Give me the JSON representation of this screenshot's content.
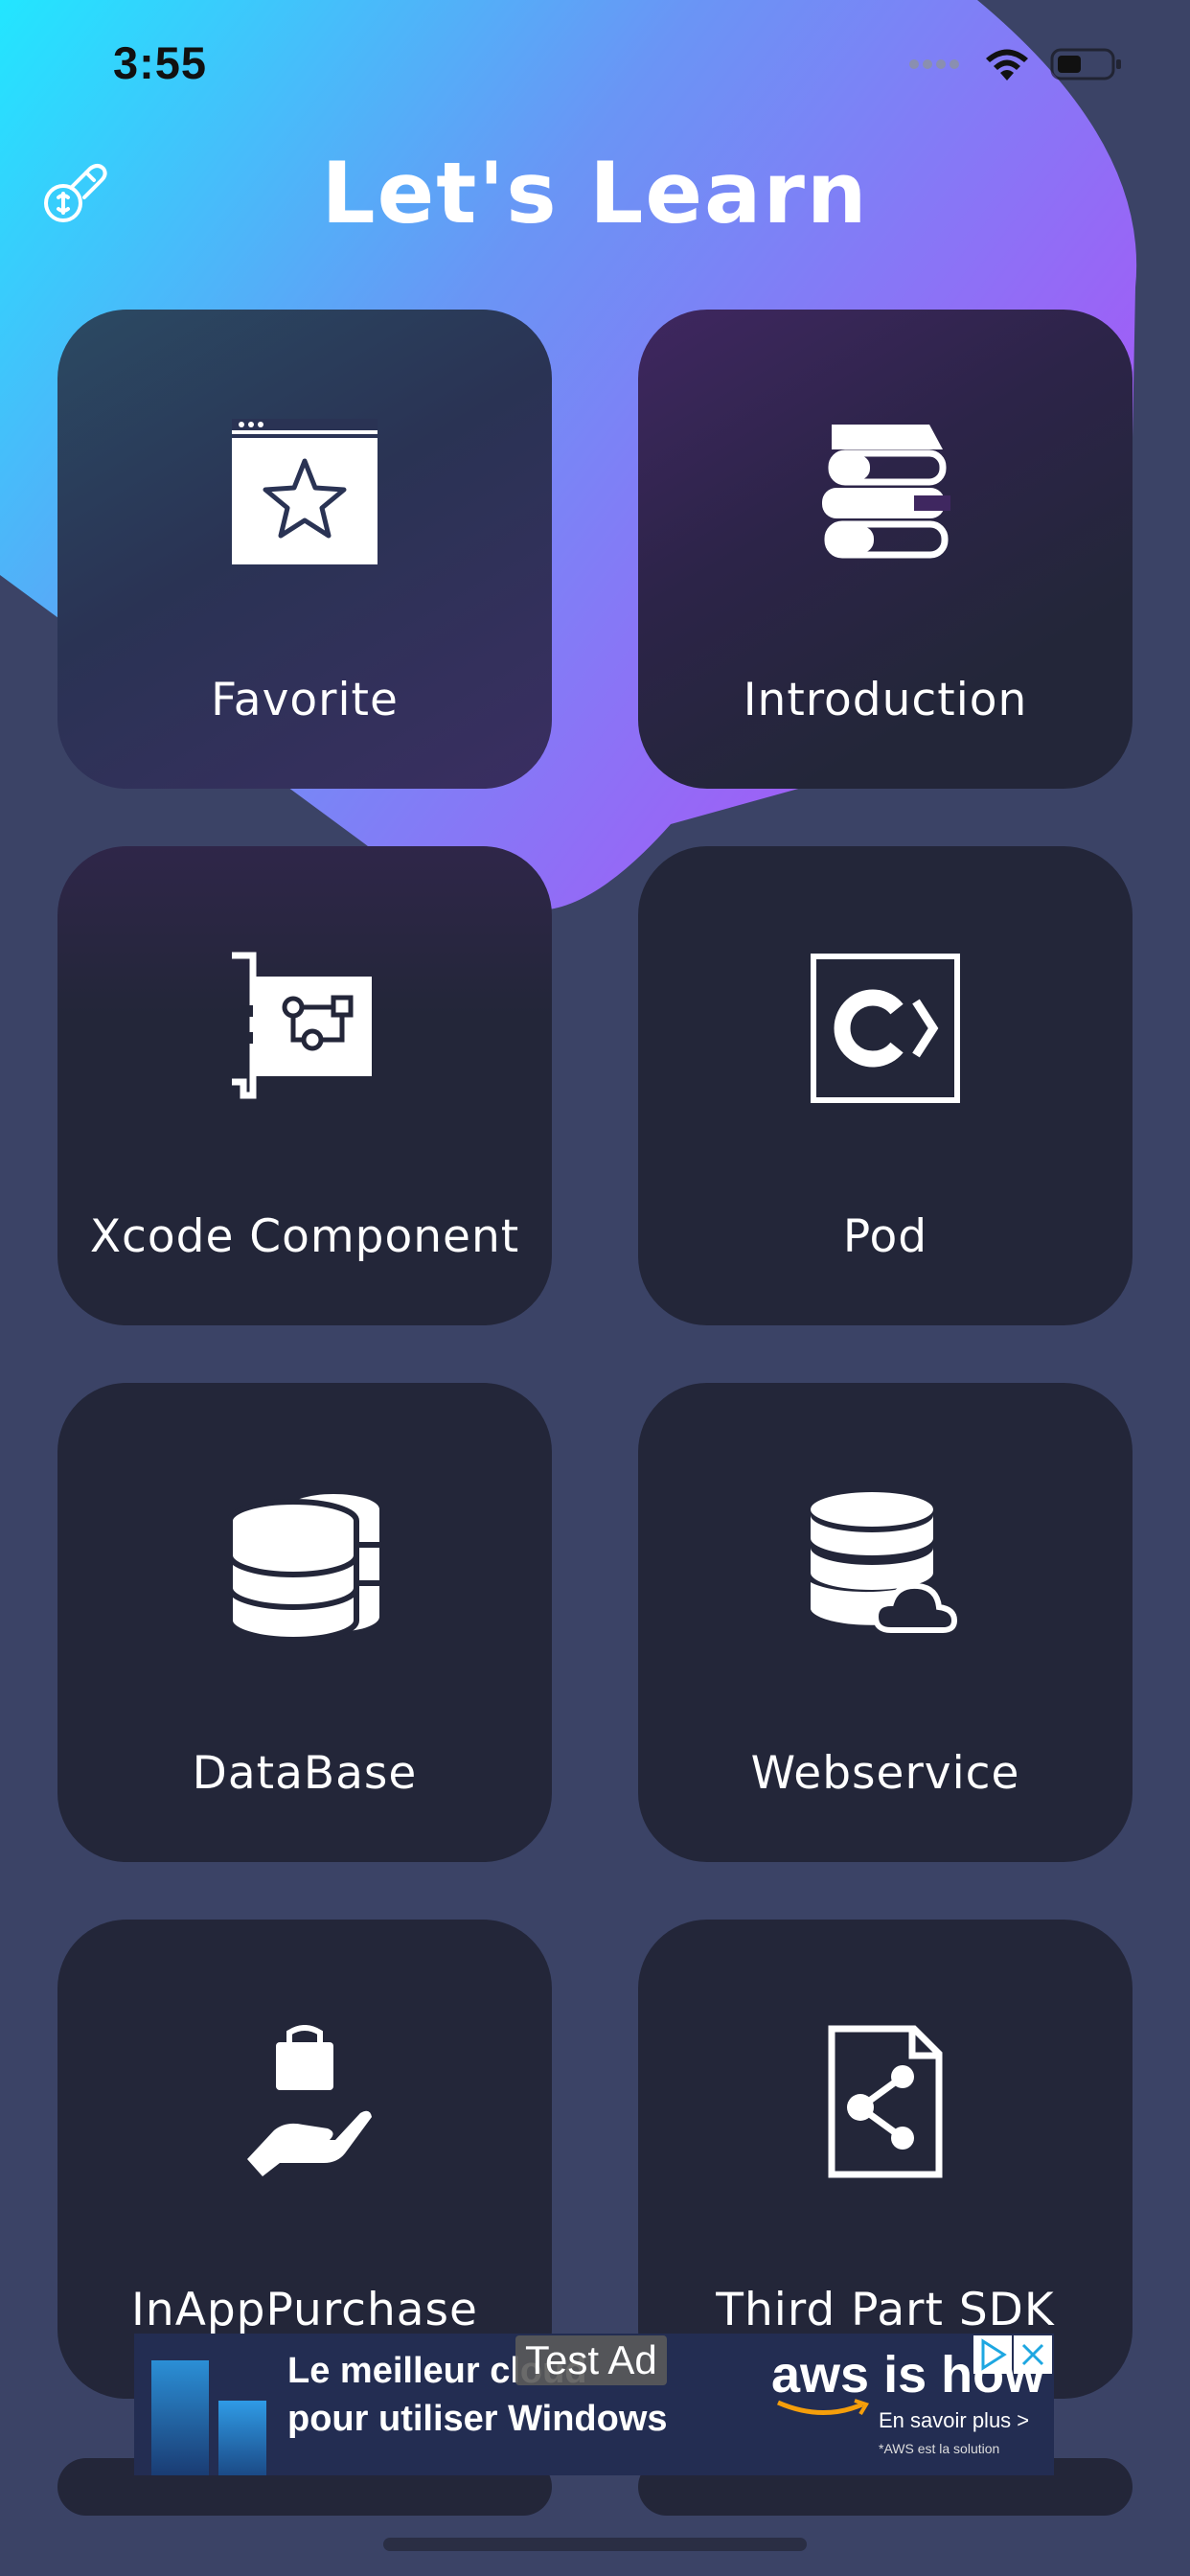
{
  "status_bar": {
    "time": "3:55"
  },
  "header": {
    "title": "Let's Learn",
    "icon": "hand-coin-icon"
  },
  "cards": [
    {
      "label": "Favorite",
      "icon": "browser-star-icon"
    },
    {
      "label": "Introduction",
      "icon": "books-icon"
    },
    {
      "label": "Xcode Component",
      "icon": "circuit-card-icon"
    },
    {
      "label": "Pod",
      "icon": "code-box-icon"
    },
    {
      "label": "DataBase",
      "icon": "database-icon"
    },
    {
      "label": "Webservice",
      "icon": "cloud-database-icon"
    },
    {
      "label": "InAppPurchase",
      "icon": "hand-bag-icon"
    },
    {
      "label": "Third Part SDK",
      "icon": "shared-file-icon"
    }
  ],
  "ad": {
    "badge": "Test Ad",
    "line1": "Le meilleur cloud",
    "line2": "pour utiliser Windows",
    "brand": "aws is how",
    "cta": "En savoir plus >",
    "note": "*AWS est la solution"
  },
  "colors": {
    "background": "#3b4366",
    "card": "#232639",
    "gradient_start": "#22e6ff",
    "gradient_end": "#a855f7"
  }
}
